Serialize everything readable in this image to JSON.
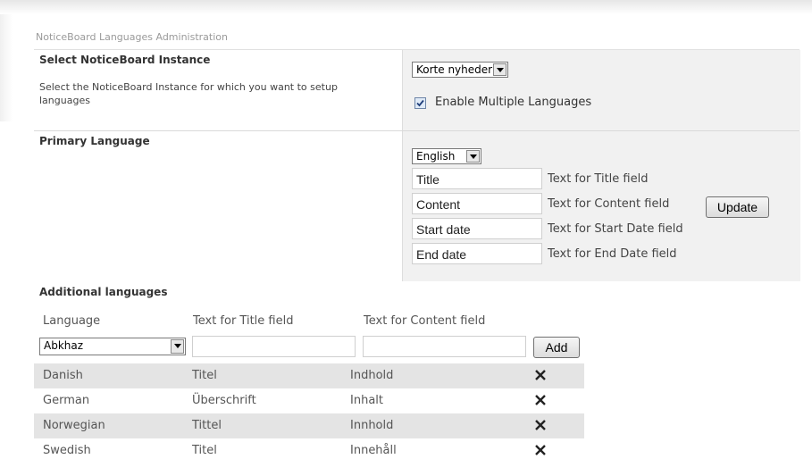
{
  "page_title": "NoticeBoard Languages Administration",
  "instance": {
    "title": "Select NoticeBoard Instance",
    "description": "Select the NoticeBoard Instance for which you want to setup languages",
    "selected": "Korte nyheder",
    "enable_multi_label": "Enable Multiple Languages",
    "enable_multi_checked": true
  },
  "primary": {
    "title": "Primary Language",
    "language": "English",
    "fields": [
      {
        "value": "Title",
        "label": "Text for Title field"
      },
      {
        "value": "Content",
        "label": "Text for Content field"
      },
      {
        "value": "Start date",
        "label": "Text for Start Date field"
      },
      {
        "value": "End date",
        "label": "Text for End Date field"
      }
    ],
    "update_label": "Update"
  },
  "additional": {
    "title": "Additional languages",
    "columns": [
      "Language",
      "Text for Title field",
      "Text for Content field"
    ],
    "new_language": "Abkhaz",
    "add_label": "Add",
    "rows": [
      {
        "language": "Danish",
        "title": "Titel",
        "content": "Indhold"
      },
      {
        "language": "German",
        "title": "Überschrift",
        "content": "Inhalt"
      },
      {
        "language": "Norwegian",
        "title": "Tittel",
        "content": "Innhold"
      },
      {
        "language": "Swedish",
        "title": "Titel",
        "content": "Innehåll"
      }
    ]
  }
}
